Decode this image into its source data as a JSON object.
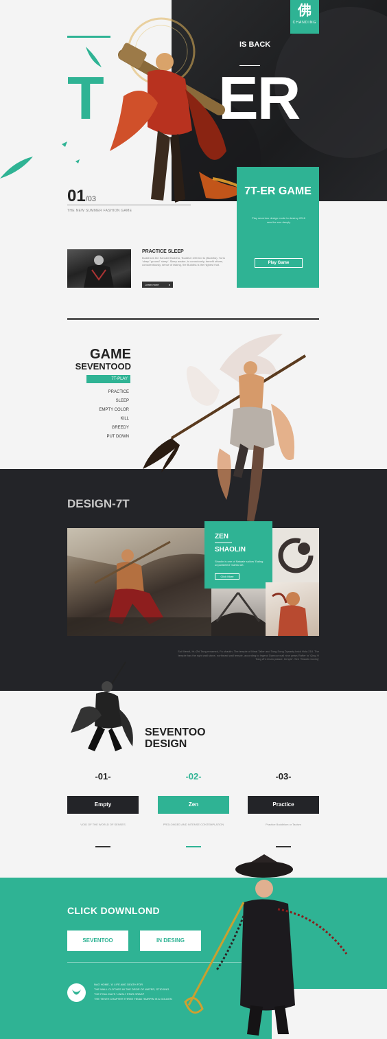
{
  "colors": {
    "accent": "#2fb394",
    "dark": "#232428",
    "light": "#f4f4f4"
  },
  "logo": {
    "glyph": "佛",
    "text": "CHANDING"
  },
  "hero": {
    "is_back": "IS BACK",
    "title_left": "T",
    "title_right": "ER",
    "number": "01",
    "number_total": "/03",
    "caption": "THE NEW SUMMER FASHION GAME"
  },
  "game_card": {
    "title": "7T-ER GAME",
    "description": "Play seventoo design mode to destroy 2016 new the sun deeply",
    "button": "Play Game"
  },
  "practice": {
    "title": "PRACTICE SLEEP",
    "description": "Buddha is the Sanskrit Buddha, 'Buddha' referred to (Buddha). Turtu 'sleep' 'ground' 'sleep'. Sleep awake, to consciously, benefit others, conscientiously, sense of talking, the Buddha is the highest fruit.",
    "learn_more": "Learn more"
  },
  "game_menu": {
    "title_1": "GAME",
    "title_2": "SEVENTOOD",
    "active": "7T-PLAY",
    "items": [
      "PRACTICE",
      "SLEEP",
      "EMPTY COLOR",
      "KILL",
      "GREEDY",
      "PUT DOWN"
    ]
  },
  "design": {
    "title": "DESIGN-7T",
    "zen_title": "ZEN",
    "zen_sub": "SHAOLIN",
    "zen_desc": "Shaolin is one of Nataale sailors 'Eating unparalleled' martial art.",
    "zen_button": "Click More",
    "caption": "Sui Wendi, Hu Zhi Tang renamed, Fu shaolin. The temple of Meat Taller and Tang Song Dynasty brick Hola 218. The temple has the right wall stone, northeast wall temple, according to legend Damour wall nine years Rafter to 'Qing Yi Tong Zhi renan palace, temple'. See 'Shaolin boxing'"
  },
  "seventoo": {
    "title_1": "SEVENTOO",
    "title_2": "DESIGN",
    "steps": [
      {
        "num": "-01-",
        "label": "Empty",
        "caption": "VOID OF THE WORLD OF SENSES"
      },
      {
        "num": "-02-",
        "label": "Zen",
        "caption": "PROLONGED AND INTENSE CONTEMPLATION"
      },
      {
        "num": "-03-",
        "label": "Practice",
        "caption": "Practice Buddhism or Taoism"
      }
    ]
  },
  "download": {
    "title": "CLICK DOWNLOND",
    "button_1": "SEVENTOO",
    "button_2": "IN DESING",
    "lines": [
      "NAO HOME, 'A' LIFE AND DEATH FOR",
      "THE WALL CLOTHES IN THE DROP OF WATER, STICKING",
      "THE FOUL DAYS 'LINGLI' STAR GRASP",
      "THE TENTH CHAPTER THREE 'HEAD HAIRPIN IS A GOLDEN"
    ]
  }
}
